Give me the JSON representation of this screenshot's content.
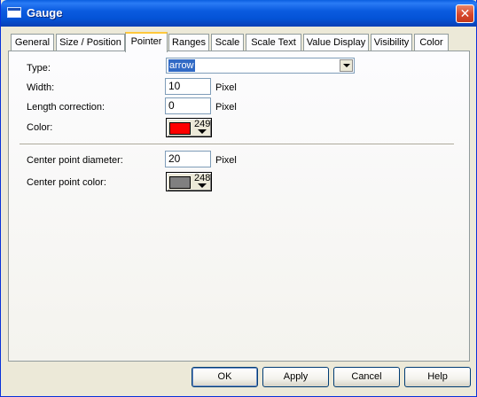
{
  "window": {
    "title": "Gauge",
    "icon": "window-icon",
    "close_label": "✕"
  },
  "tabs": [
    {
      "label": "General"
    },
    {
      "label": "Size / Position"
    },
    {
      "label": "Pointer",
      "active": true
    },
    {
      "label": "Ranges"
    },
    {
      "label": "Scale"
    },
    {
      "label": "Scale Text"
    },
    {
      "label": "Value Display"
    },
    {
      "label": "Visibility"
    },
    {
      "label": "Color"
    }
  ],
  "pointer": {
    "type_label": "Type:",
    "type_value": "arrow",
    "width_label": "Width:",
    "width_value": "10",
    "width_unit": "Pixel",
    "length_label": "Length correction:",
    "length_value": "0",
    "length_unit": "Pixel",
    "color_label": "Color:",
    "color_index": "249",
    "color_hex": "#ff0000",
    "center_diameter_label": "Center point diameter:",
    "center_diameter_value": "20",
    "center_diameter_unit": "Pixel",
    "center_color_label": "Center point color:",
    "center_color_index": "248",
    "center_color_hex": "#808080"
  },
  "buttons": {
    "ok": "OK",
    "apply": "Apply",
    "cancel": "Cancel",
    "help": "Help"
  }
}
